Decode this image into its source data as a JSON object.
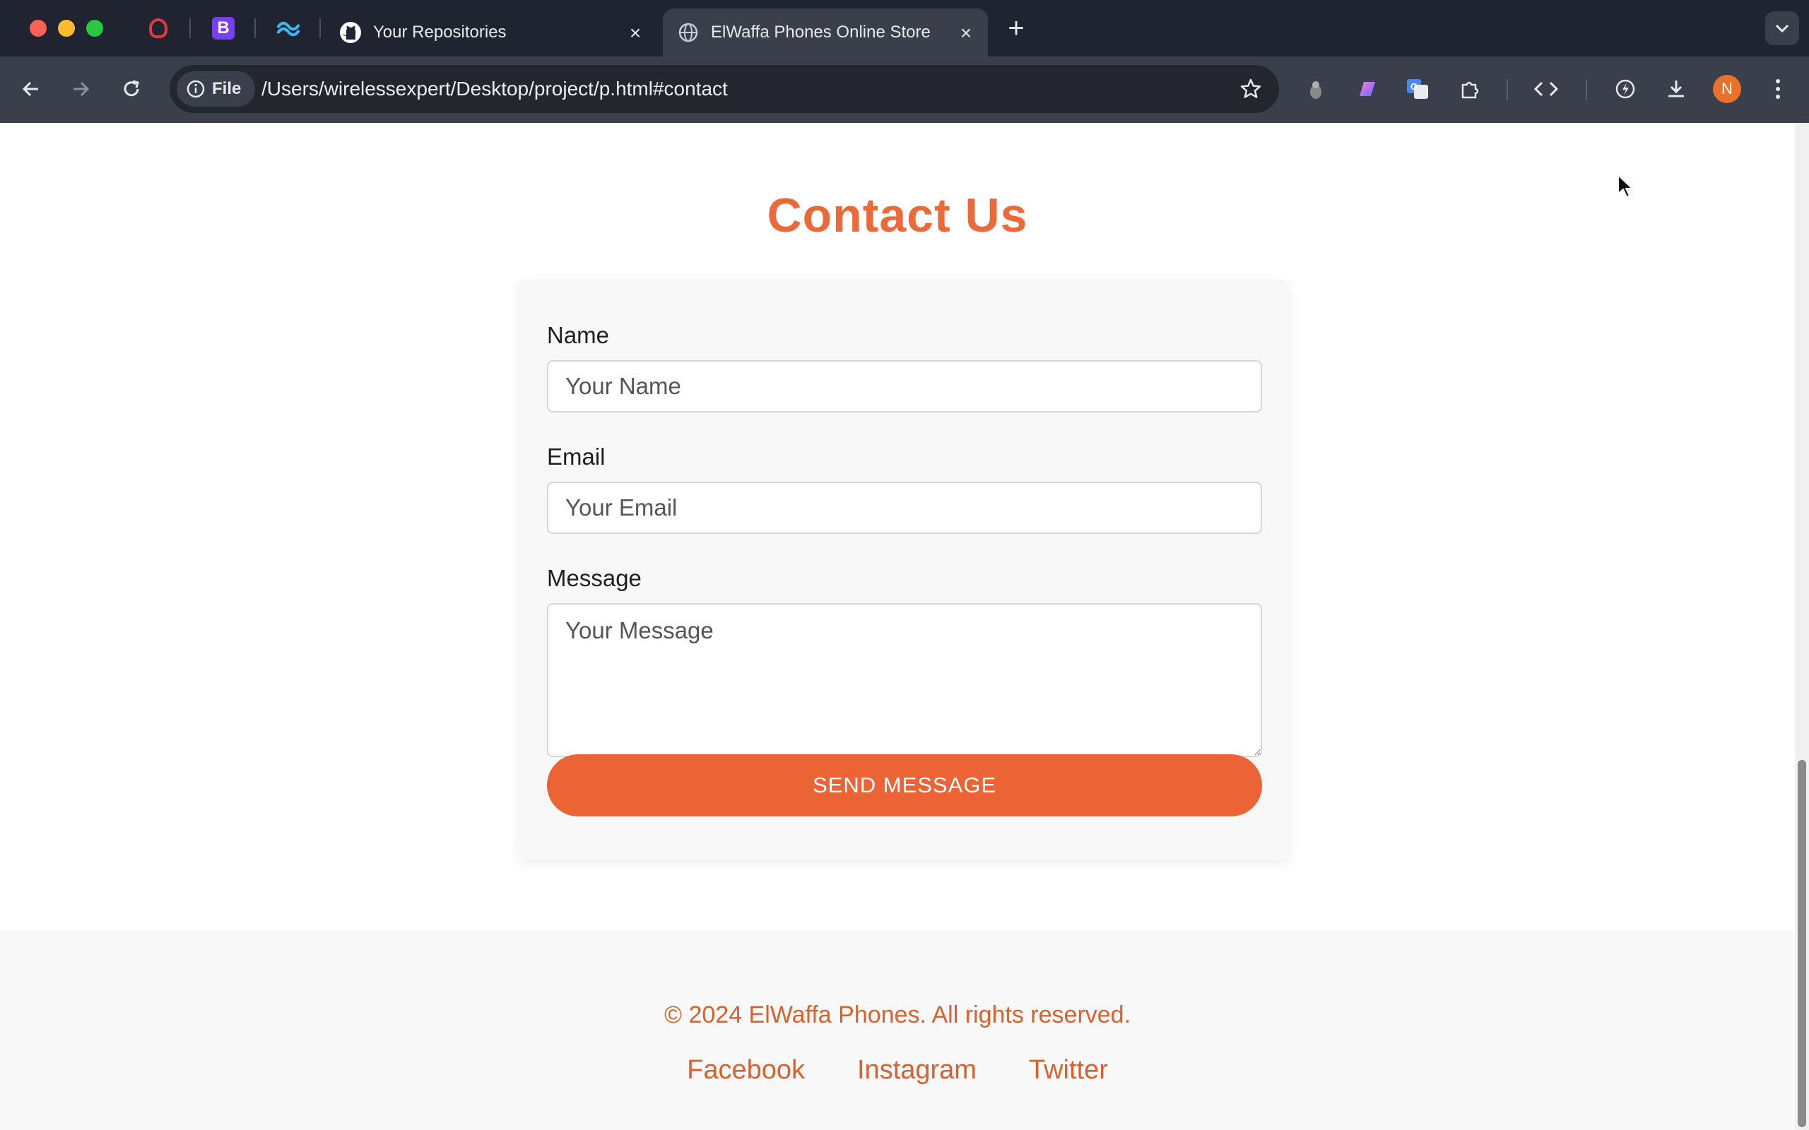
{
  "browser": {
    "tabs": [
      {
        "title": "Your Repositories",
        "icon": "github-icon"
      },
      {
        "title": "ElWaffa Phones Online Store",
        "icon": "globe-icon",
        "active": true
      }
    ],
    "pinned_tabs": [
      {
        "icon": "red-o-icon"
      },
      {
        "icon": "bootstrap-icon",
        "glyph": "B"
      },
      {
        "icon": "tailwind-icon"
      }
    ],
    "address": {
      "scheme_label": "File",
      "url": "/Users/wirelessexpert/Desktop/project/p.html#contact"
    },
    "profile_initial": "N"
  },
  "contact": {
    "title": "Contact Us",
    "name_label": "Name",
    "name_placeholder": "Your Name",
    "email_label": "Email",
    "email_placeholder": "Your Email",
    "message_label": "Message",
    "message_placeholder": "Your Message",
    "submit_label": "SEND MESSAGE"
  },
  "footer": {
    "copyright": "© 2024 ElWaffa Phones. All rights reserved.",
    "links": [
      "Facebook",
      "Instagram",
      "Twitter"
    ]
  },
  "colors": {
    "accent": "#ec6435",
    "footer_text": "#d9612e",
    "chrome_bg": "#1f2430",
    "toolbar_bg": "#3a3f4b"
  }
}
